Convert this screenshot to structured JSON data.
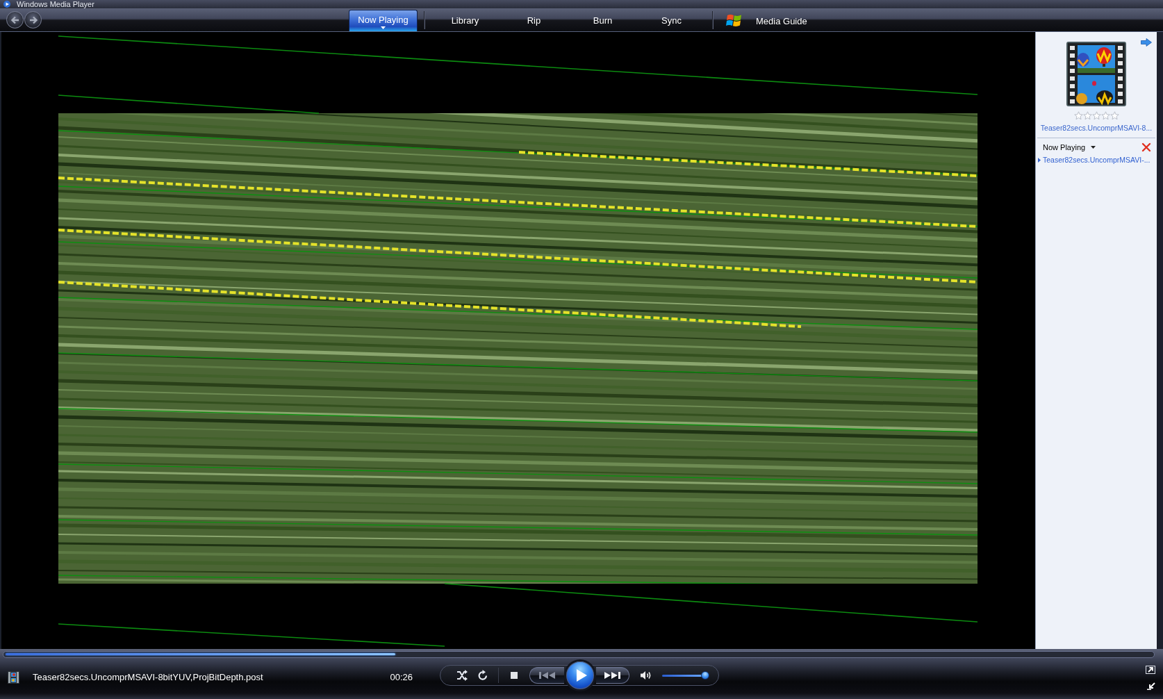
{
  "window": {
    "title": "Windows Media Player"
  },
  "navigation": {
    "tabs": [
      {
        "label": "Now Playing",
        "selected": true
      },
      {
        "label": "Library",
        "selected": false
      },
      {
        "label": "Rip",
        "selected": false
      },
      {
        "label": "Burn",
        "selected": false
      },
      {
        "label": "Sync",
        "selected": false
      }
    ],
    "media_guide": {
      "label": "Media Guide"
    }
  },
  "now_playing_pane": {
    "media_title": "Teaser82secs.UncomprMSAVI-8...",
    "stars": 0,
    "list_menu": "Now Playing",
    "playlist": [
      {
        "label": "Teaser82secs.UncomprMSAVI-...",
        "selected": true
      }
    ]
  },
  "player": {
    "seek": {
      "level": 0.34
    },
    "file_name": "Teaser82secs.UncomprMSAVI-8bitYUV,ProjBitDepth.post",
    "time": "00:26",
    "playing": false,
    "volume": {
      "level": 0.92
    }
  }
}
